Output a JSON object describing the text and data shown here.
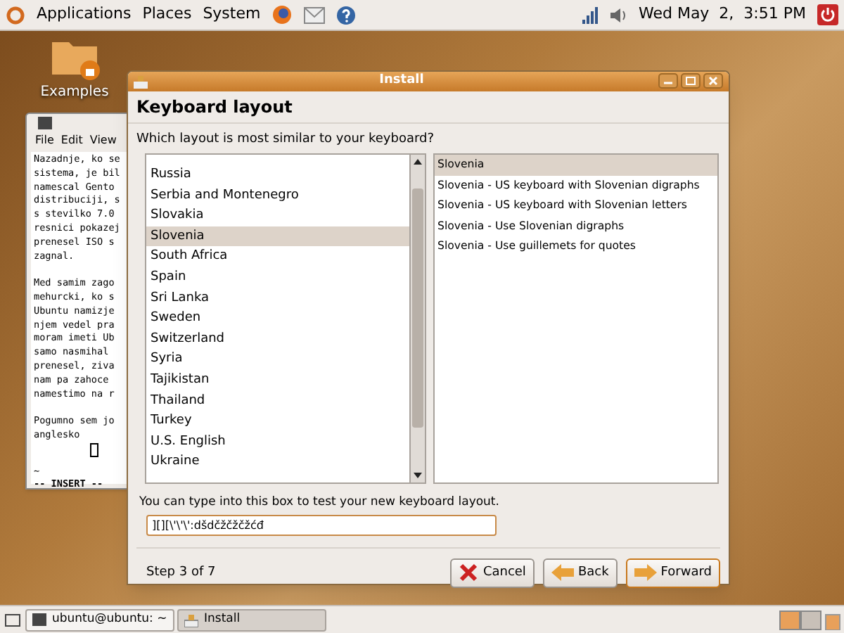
{
  "top_panel": {
    "menus": [
      "Applications",
      "Places",
      "System"
    ],
    "clock": "Wed May  2,  3:51 PM"
  },
  "desktop_icons": [
    {
      "label": "Examples"
    }
  ],
  "terminal": {
    "menus": [
      "File",
      "Edit",
      "View"
    ],
    "paragraphs": [
      [
        "Nazadnje, ko se",
        "sistema, je bil",
        "namescal Gento",
        "distribuciji, s",
        "s stevilko 7.0",
        "resnici pokazej",
        "prenesel ISO s",
        "zagnal."
      ],
      [
        "Med samim zago",
        "mehurcki, ko s",
        "Ubuntu namizje",
        "njem vedel pra",
        "moram imeti Ub",
        "samo nasmihal",
        "prenesel, ziva",
        "nam pa zahoce",
        "namestimo na r"
      ],
      [
        "Pogumno sem jo",
        "anglesko"
      ]
    ],
    "tilde": "~",
    "mode": "-- INSERT --"
  },
  "installer": {
    "title": "Install",
    "heading": "Keyboard layout",
    "prompt": "Which layout is most similar to your keyboard?",
    "countries": [
      {
        "label": "Russia",
        "selected": false
      },
      {
        "label": "Serbia and Montenegro",
        "selected": false
      },
      {
        "label": "Slovakia",
        "selected": false
      },
      {
        "label": "Slovenia",
        "selected": true
      },
      {
        "label": "South Africa",
        "selected": false
      },
      {
        "label": "Spain",
        "selected": false
      },
      {
        "label": "Sri Lanka",
        "selected": false
      },
      {
        "label": "Sweden",
        "selected": false
      },
      {
        "label": "Switzerland",
        "selected": false
      },
      {
        "label": "Syria",
        "selected": false
      },
      {
        "label": "Tajikistan",
        "selected": false
      },
      {
        "label": "Thailand",
        "selected": false
      },
      {
        "label": "Turkey",
        "selected": false
      },
      {
        "label": "U.S. English",
        "selected": false
      },
      {
        "label": "Ukraine",
        "selected": false
      }
    ],
    "variants": [
      {
        "label": "Slovenia",
        "selected": true
      },
      {
        "label": "Slovenia - US keyboard with Slovenian digraphs",
        "selected": false
      },
      {
        "label": "Slovenia - US keyboard with Slovenian letters",
        "selected": false
      },
      {
        "label": "Slovenia - Use Slovenian digraphs",
        "selected": false
      },
      {
        "label": "Slovenia - Use guillemets for quotes",
        "selected": false
      }
    ],
    "test_label": "You can type into this box to test your new keyboard layout.",
    "test_value": "][][\\'\\'\\':dšdčžčžčžćđ",
    "step": "Step 3 of 7",
    "buttons": [
      {
        "label": "Cancel",
        "kind": "cancel"
      },
      {
        "label": "Back",
        "kind": "back"
      },
      {
        "label": "Forward",
        "kind": "forward"
      }
    ]
  },
  "taskbar": {
    "tasks": [
      {
        "label": "ubuntu@ubuntu: ~",
        "kind": "terminal",
        "selected": false
      },
      {
        "label": "Install",
        "kind": "installer",
        "selected": true
      }
    ]
  }
}
